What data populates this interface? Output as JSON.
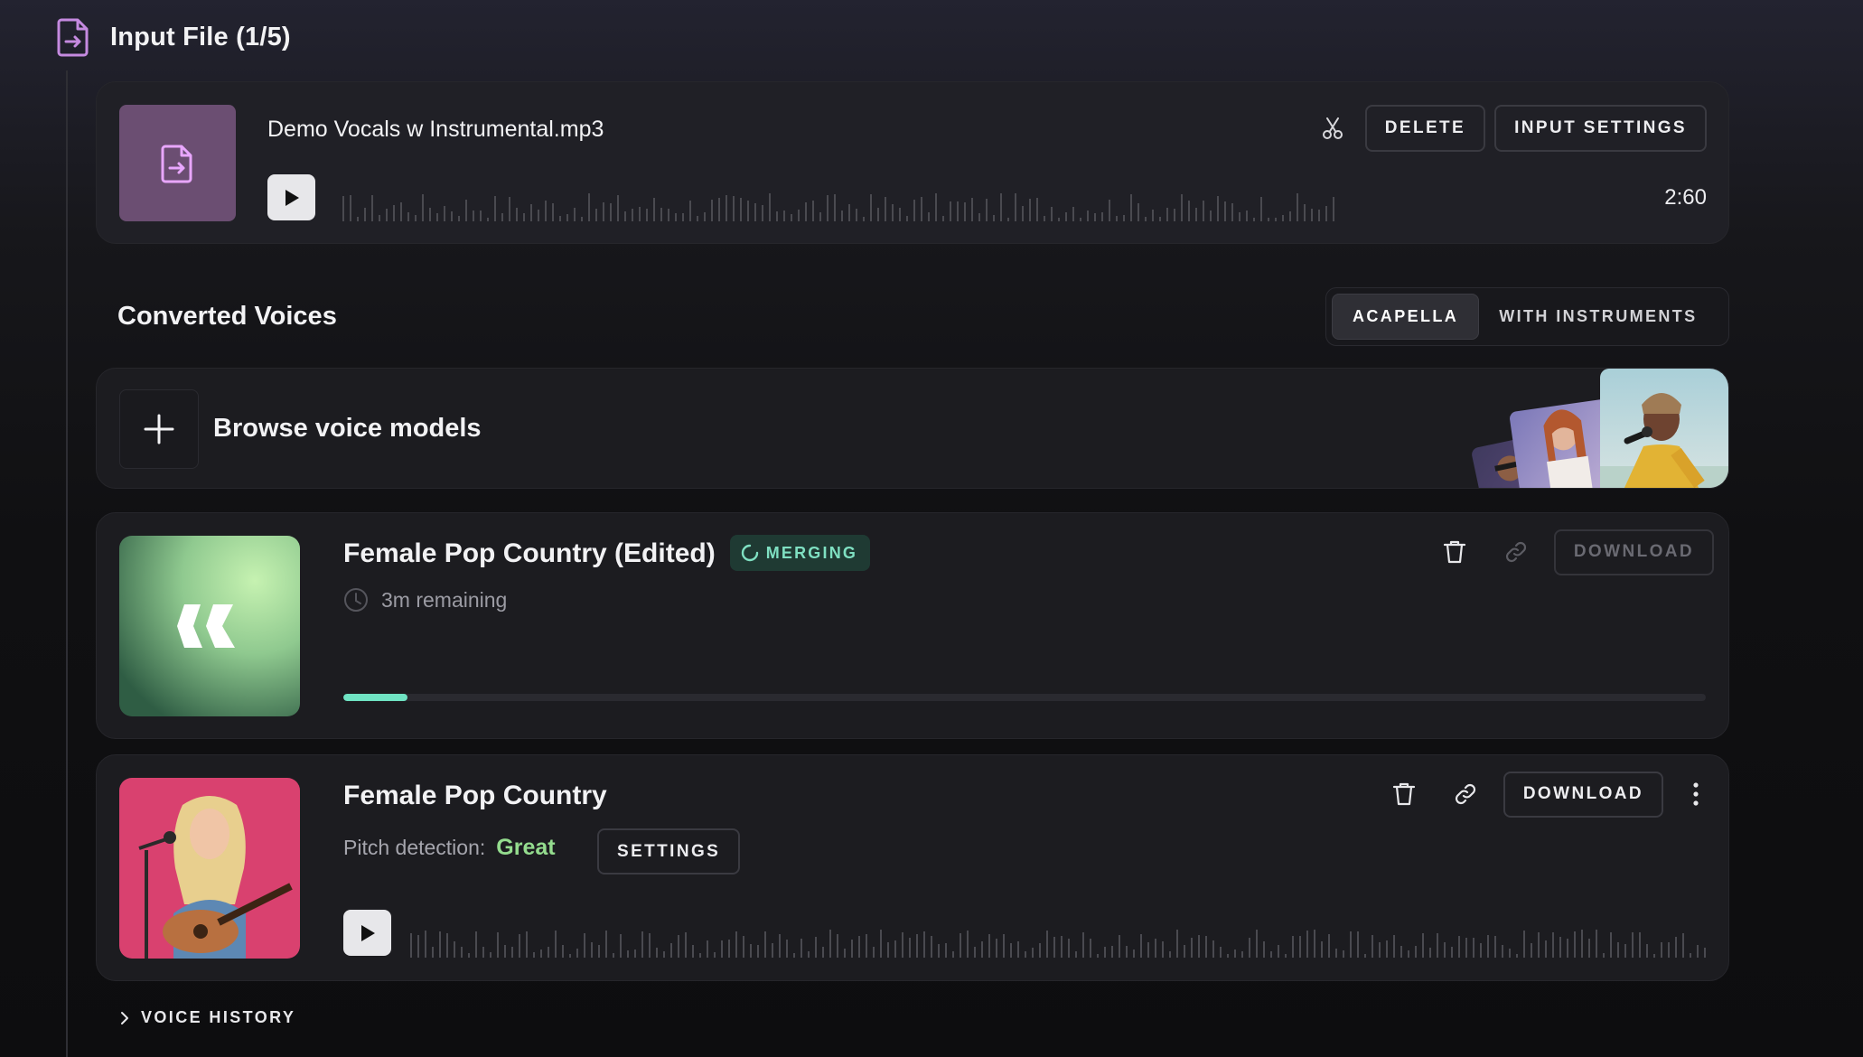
{
  "input_file": {
    "header_title": "Input File (1/5)",
    "file_name": "Demo Vocals w Instrumental.mp3",
    "duration": "2:60",
    "actions": {
      "delete_label": "DELETE",
      "settings_label": "INPUT SETTINGS"
    },
    "icons": [
      "file-import-icon",
      "scissors-icon",
      "play-icon"
    ]
  },
  "converted_voices": {
    "title": "Converted Voices",
    "tabs": [
      {
        "label": "ACAPELLA",
        "active": true
      },
      {
        "label": "WITH INSTRUMENTS",
        "active": false
      }
    ],
    "browse_label": "Browse voice models",
    "items": [
      {
        "title": "Female Pop Country (Edited)",
        "status_badge": "MERGING",
        "remaining": "3m remaining",
        "progress": 0.047,
        "download_label": "DOWNLOAD",
        "download_enabled": false
      },
      {
        "title": "Female Pop Country",
        "pitch_label": "Pitch detection:",
        "pitch_value": "Great",
        "settings_label": "SETTINGS",
        "download_label": "DOWNLOAD",
        "download_enabled": true
      }
    ]
  },
  "voice_history": {
    "label": "VOICE HISTORY"
  },
  "colors": {
    "accent_mint": "#6fe3c3",
    "pitch_great": "#94dc8e",
    "file_thumb": "#6b4e72",
    "header_icon": "#c58ae0"
  }
}
